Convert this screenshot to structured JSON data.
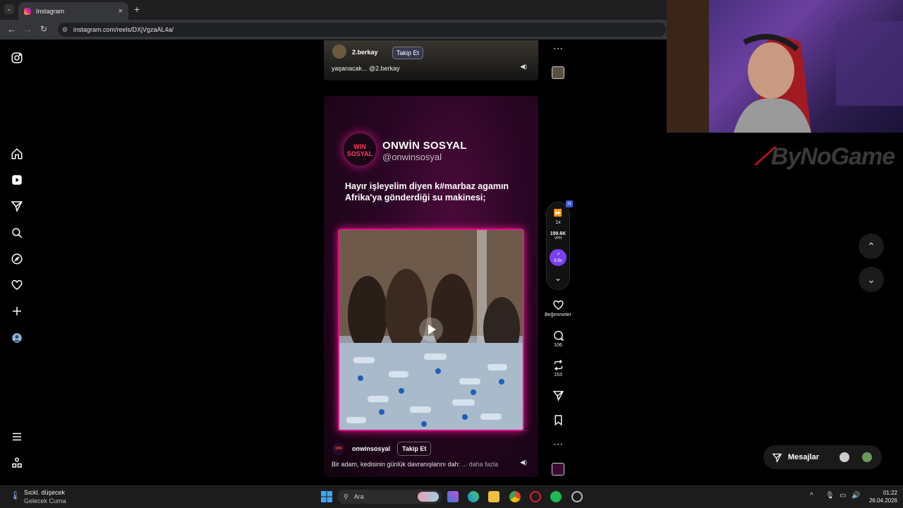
{
  "browser": {
    "tab_title": "Instagram",
    "tab_close": "×",
    "new_tab": "+",
    "url": "instagram.com/reels/DXjVgzaAL4a/"
  },
  "prev_reel": {
    "username": "2.berkay",
    "follow_label": "Takip Et",
    "caption": "yaşanacak... @2.berkay"
  },
  "reel": {
    "brand_logo_text": "WIN\nSOSYAL",
    "brand_name": "ONWİN SOSYAL",
    "brand_handle": "@onwinsosyal",
    "overlay_text": "Hayır işleyelim diyen k#marbaz agamın Afrika'ya gönderdiği su makinesi;",
    "username": "onwinsosyal",
    "follow_label": "Takip Et",
    "description": "Bir adam, kedisinin günlük davranışlarını dah:",
    "more_label": "... daha fazla"
  },
  "extension": {
    "speed": "1x",
    "views": "199.6K",
    "views_unit": "VPH",
    "multiplier": "6.9x"
  },
  "actions": {
    "likes_label": "Beğenmeler",
    "comments": "106",
    "reposts": "153"
  },
  "messages": {
    "label": "Mesajlar"
  },
  "overlay": {
    "logo_text": "ByNoGame"
  },
  "taskbar": {
    "weather_title": "Sıckl. düşecek",
    "weather_sub": "Gelecek Cuma",
    "search_label": "Ara",
    "time": "01:22",
    "date": "26.04.2026"
  },
  "colors": {
    "accent": "#e0138a",
    "instagram_bg": "#000000",
    "ext_purple": "#7b3ff2"
  }
}
